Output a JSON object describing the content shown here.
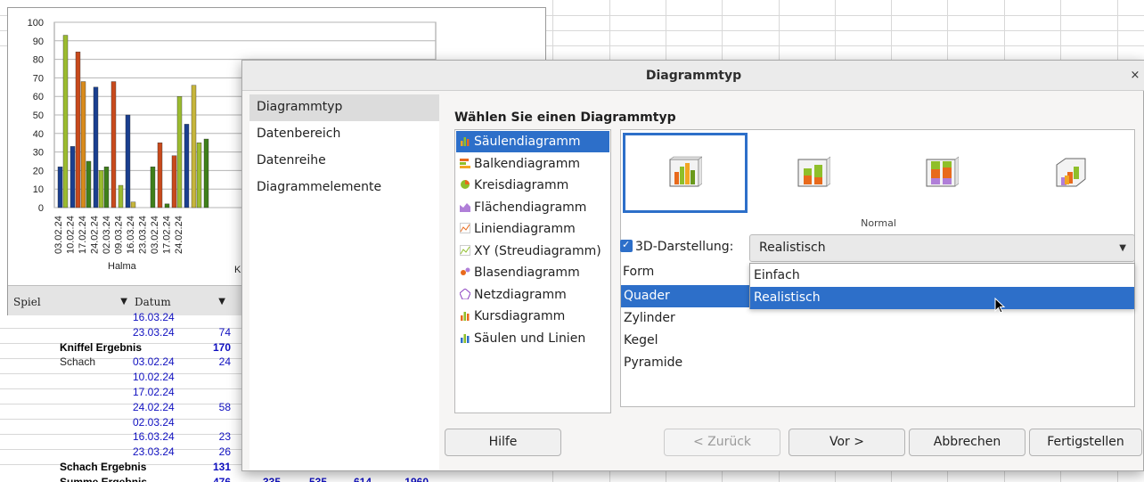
{
  "chart": {
    "y_ticks": [
      "100",
      "90",
      "80",
      "70",
      "60",
      "50",
      "40",
      "30",
      "20",
      "10",
      "0"
    ],
    "x_dates": [
      "03.02.24",
      "10.02.24",
      "17.02.24",
      "24.02.24",
      "02.03.24",
      "09.03.24",
      "16.03.24",
      "23.03.24",
      "03.02.24",
      "17.02.24",
      "24.02.24"
    ],
    "group_labels": [
      "Halma",
      "K"
    ],
    "colors": [
      "#1a3f8f",
      "#9bbb2f",
      "#d88a1b",
      "#3f7f1a",
      "#c6b53b",
      "#c84a1c"
    ],
    "pivot_fields": [
      {
        "label": "Spiel"
      },
      {
        "label": "Datum"
      }
    ]
  },
  "sheet_table": {
    "rows": [
      {
        "label": "",
        "date": "16.03.24",
        "value": ""
      },
      {
        "label": "",
        "date": "23.03.24",
        "value": "74"
      },
      {
        "label": "Kniffel Ergebnis",
        "date": "",
        "value": "170",
        "bold": true
      },
      {
        "label": "Schach",
        "date": "03.02.24",
        "value": "24"
      },
      {
        "label": "",
        "date": "10.02.24",
        "value": ""
      },
      {
        "label": "",
        "date": "17.02.24",
        "value": ""
      },
      {
        "label": "",
        "date": "24.02.24",
        "value": "58"
      },
      {
        "label": "",
        "date": "02.03.24",
        "value": ""
      },
      {
        "label": "",
        "date": "16.03.24",
        "value": "23"
      },
      {
        "label": "",
        "date": "23.03.24",
        "value": "26"
      },
      {
        "label": "Schach Ergebnis",
        "date": "",
        "value": "131",
        "bold": true
      },
      {
        "label": "Summe Ergebnis",
        "date": "",
        "value": "476",
        "bold": true
      }
    ],
    "summary_extra": [
      "335",
      "535",
      "614",
      "1960"
    ]
  },
  "dialog": {
    "title": "Diagrammtyp",
    "close_glyph": "×",
    "nav": [
      {
        "label": "Diagrammtyp",
        "selected": true
      },
      {
        "label": "Datenbereich"
      },
      {
        "label": "Datenreihe"
      },
      {
        "label": "Diagrammelemente"
      }
    ],
    "heading": "Wählen Sie einen Diagrammtyp",
    "chart_types": [
      {
        "label": "Säulendiagramm",
        "icon": "column-chart-icon",
        "selected": true
      },
      {
        "label": "Balkendiagramm",
        "icon": "bar-chart-icon"
      },
      {
        "label": "Kreisdiagramm",
        "icon": "pie-chart-icon"
      },
      {
        "label": "Flächendiagramm",
        "icon": "area-chart-icon"
      },
      {
        "label": "Liniendiagramm",
        "icon": "line-chart-icon"
      },
      {
        "label": "XY (Streudiagramm)",
        "icon": "scatter-chart-icon"
      },
      {
        "label": "Blasendiagramm",
        "icon": "bubble-chart-icon"
      },
      {
        "label": "Netzdiagramm",
        "icon": "net-chart-icon"
      },
      {
        "label": "Kursdiagramm",
        "icon": "stock-chart-icon"
      },
      {
        "label": "Säulen und Linien",
        "icon": "column-line-chart-icon"
      }
    ],
    "variant_label": "Normal",
    "variants": [
      {
        "icon": "3d-column-normal-icon",
        "selected": true
      },
      {
        "icon": "3d-column-stacked-icon"
      },
      {
        "icon": "3d-column-percent-stacked-icon"
      },
      {
        "icon": "3d-column-deep-icon"
      }
    ],
    "three_d": {
      "label": "3D-Darstellung:",
      "checked": true
    },
    "combo": {
      "value": "Realistisch",
      "arrow": "▼"
    },
    "dropdown_options": [
      {
        "label": "Einfach"
      },
      {
        "label": "Realistisch",
        "selected": true
      }
    ],
    "form_label": "Form",
    "shapes": [
      {
        "label": "Quader",
        "selected": true
      },
      {
        "label": "Zylinder"
      },
      {
        "label": "Kegel"
      },
      {
        "label": "Pyramide"
      }
    ],
    "buttons": {
      "help": "Hilfe",
      "back": "< Zurück",
      "next": "Vor >",
      "cancel": "Abbrechen",
      "finish": "Fertigstellen"
    }
  }
}
